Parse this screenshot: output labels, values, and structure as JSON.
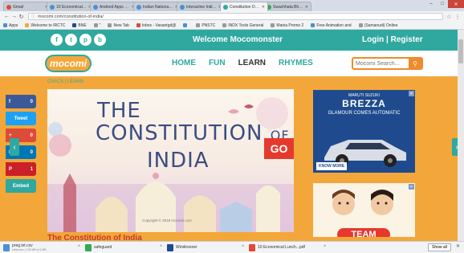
{
  "browser": {
    "tabs": [
      {
        "label": "Gmail",
        "color": "#dd4b39",
        "active": false
      },
      {
        "label": "10 Economical Lunc",
        "color": "#4a90d9",
        "active": false
      },
      {
        "label": "Android Apps on Go",
        "color": "#4a90d9",
        "active": false
      },
      {
        "label": "Indian National Syn",
        "color": "#4a90d9",
        "active": false
      },
      {
        "label": "Interactive India Ar",
        "color": "#4a90d9",
        "active": false
      },
      {
        "label": "Constitution Of Indi",
        "color": "#2fa8a0",
        "active": true
      },
      {
        "label": "Swachhata Bhagir",
        "color": "#34a853",
        "active": false
      }
    ],
    "url": "mocomi.com/constitution-of-india/",
    "bookmarks": [
      {
        "label": "Apps",
        "color": "#4a90d9"
      },
      {
        "label": "Welcome to IRCTC",
        "color": "#f3a73a"
      },
      {
        "label": "BNE",
        "color": "#1f4b8e"
      },
      {
        "label": "\"",
        "color": "#999999"
      },
      {
        "label": "New Tab",
        "color": "#999999"
      },
      {
        "label": "Inbox - Vasantgd@",
        "color": "#dd4b39"
      },
      {
        "label": "",
        "color": "#4a90d9"
      },
      {
        "label": "PNSTC",
        "color": "#999999"
      },
      {
        "label": "INDX Tools General",
        "color": "#999999"
      },
      {
        "label": "Mania Promo 2",
        "color": "#999999"
      },
      {
        "label": "Free Animation and",
        "color": "#4a90d9"
      },
      {
        "label": "(Samanudi) Online",
        "color": "#999999"
      }
    ]
  },
  "site": {
    "welcome": "Welcome Mocomonster",
    "login": "Login",
    "separator": "|",
    "register": "Register",
    "logo": "mocomi",
    "nav": [
      {
        "label": "HOME",
        "active": false
      },
      {
        "label": "FUN",
        "active": false
      },
      {
        "label": "LEARN",
        "active": true
      },
      {
        "label": "RHYMES",
        "active": false
      }
    ],
    "search_placeholder": "Mocomi Search...",
    "search_icon": "search-icon",
    "social_top": [
      "f",
      "t",
      "p",
      "b"
    ],
    "breadcrumb_a": "CIVICS",
    "breadcrumb_sep": " | ",
    "breadcrumb_b": "LEARN"
  },
  "side_social": [
    {
      "name": "facebook",
      "icon": "f",
      "count": "0"
    },
    {
      "name": "twitter",
      "label": "Tweet"
    },
    {
      "name": "google-plus",
      "icon": "+",
      "count": "0"
    },
    {
      "name": "linkedin",
      "icon": "in",
      "count": "0"
    },
    {
      "name": "pinterest",
      "icon": "P",
      "count": "1"
    },
    {
      "name": "embed",
      "label": "Embed"
    }
  ],
  "hero": {
    "line1": "THE",
    "line2": "CONSTITUTION",
    "line2b": "OF",
    "line3": "INDIA",
    "go": "GO",
    "caption": "Copyright © 2018 mocomi.com"
  },
  "article_title": "The Constitution of India",
  "ad1": {
    "brand": "MARUTI SUZUKI",
    "model": "BREZZA",
    "tagline": "GLAMOUR COMES AUTOMATIC",
    "cta": "KNOW MORE"
  },
  "ad2": {
    "text": "TEAM"
  },
  "downloads": [
    {
      "name": "preg.txt.csv",
      "sub": "Unknown, 1.00 MB of 4 MB",
      "color": "#4a90d9"
    },
    {
      "name": "safeguard",
      "sub": "",
      "color": "#34a853"
    },
    {
      "name": "Windirsoner",
      "sub": "",
      "color": "#1f4b8e"
    },
    {
      "name": "10 Economical Lunch...pdf",
      "sub": "",
      "color": "#dd4b39"
    }
  ],
  "show_all": "Show all"
}
